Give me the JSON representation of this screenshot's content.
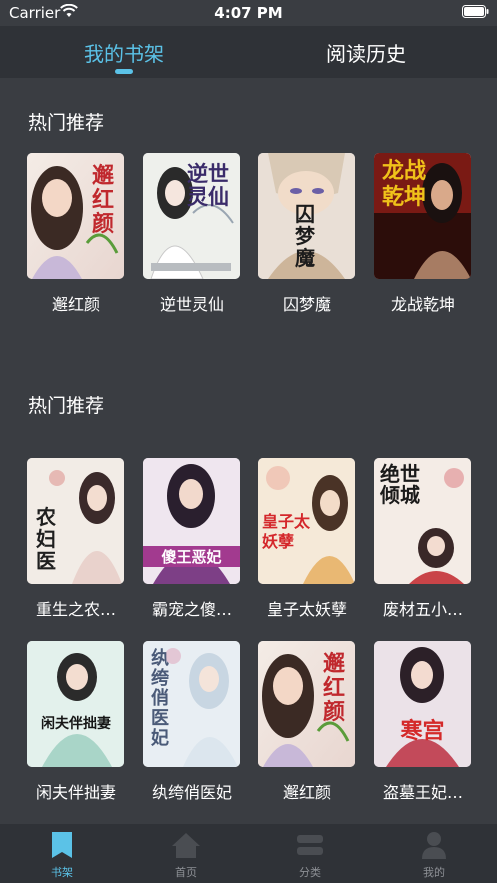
{
  "status": {
    "carrier": "Carrier",
    "time": "4:07 PM"
  },
  "top_tabs": [
    {
      "label": "我的书架"
    },
    {
      "label": "阅读历史"
    }
  ],
  "sections": [
    {
      "title": "热门推荐",
      "books": [
        {
          "title": "邂红颜",
          "cover_text": "邂红颜"
        },
        {
          "title": "逆世灵仙",
          "cover_text": "逆世灵仙"
        },
        {
          "title": "囚梦魔",
          "cover_text": "囚梦魔"
        },
        {
          "title": "龙战乾坤",
          "cover_text": "龙战乾坤"
        }
      ]
    },
    {
      "title": "热门推荐",
      "books": [
        {
          "title": "重生之农…",
          "cover_text": "农妇医"
        },
        {
          "title": "霸宠之傻…",
          "cover_text": "傻王恶妃"
        },
        {
          "title": "皇子太妖孽",
          "cover_text": "皇子太妖孽"
        },
        {
          "title": "废材五小…",
          "cover_text": "绝世倾城"
        },
        {
          "title": "闲夫伴拙妻",
          "cover_text": "闲夫伴拙妻"
        },
        {
          "title": "纨绔俏医妃",
          "cover_text": "纨绔俏医妃"
        },
        {
          "title": "邂红颜",
          "cover_text": "邂红颜"
        },
        {
          "title": "盗墓王妃…",
          "cover_text": "寒宫"
        }
      ]
    }
  ],
  "bottom_nav": [
    {
      "label": "书架",
      "icon": "bookmark-icon",
      "active": true
    },
    {
      "label": "首页",
      "icon": "home-icon",
      "active": false
    },
    {
      "label": "分类",
      "icon": "category-icon",
      "active": false
    },
    {
      "label": "我的",
      "icon": "profile-icon",
      "active": false
    }
  ],
  "colors": {
    "background": "#3a3d42",
    "bar": "#2f3237",
    "accent": "#5bc2e7",
    "inactive": "#8d9095"
  }
}
